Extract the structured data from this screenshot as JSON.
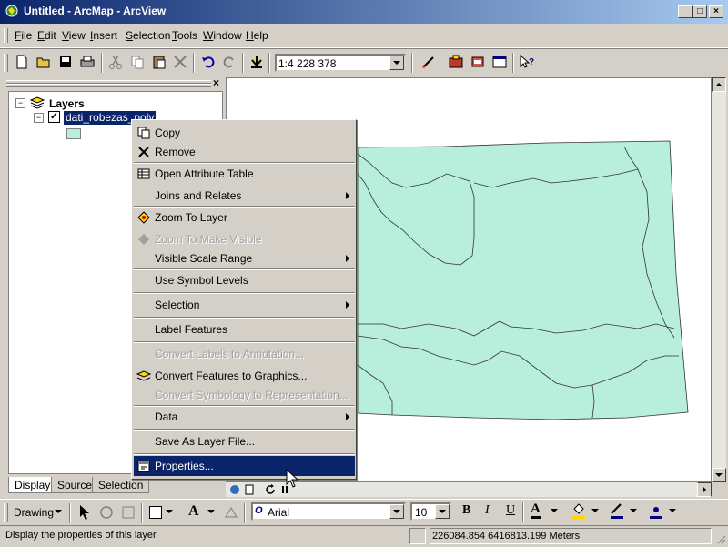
{
  "window": {
    "title": "Untitled - ArcMap - ArcView",
    "minimize": "_",
    "maximize": "□",
    "close": "×"
  },
  "menubar": [
    {
      "label": "File",
      "u": "F",
      "rest": "ile"
    },
    {
      "label": "Edit",
      "u": "E",
      "rest": "dit"
    },
    {
      "label": "View",
      "u": "V",
      "rest": "iew"
    },
    {
      "label": "Insert",
      "u": "I",
      "rest": "nsert"
    },
    {
      "label": "Selection",
      "u": "S",
      "rest": "election"
    },
    {
      "label": "Tools",
      "u": "T",
      "rest": "ools"
    },
    {
      "label": "Window",
      "u": "W",
      "rest": "indow"
    },
    {
      "label": "Help",
      "u": "H",
      "rest": "elp"
    }
  ],
  "toolbar": {
    "scale": "1:4 228 378"
  },
  "toc": {
    "layers_label": "Layers",
    "layer_name": "dati_robezas_poly",
    "tabs": [
      "Display",
      "Source",
      "Selection"
    ],
    "close": "×"
  },
  "context_menu": {
    "items": [
      {
        "label": "Copy",
        "disabled": false,
        "submenu": false
      },
      {
        "label": "Remove",
        "disabled": false,
        "submenu": false
      },
      {
        "label": "Open Attribute Table",
        "disabled": false,
        "submenu": false
      },
      {
        "label": "Joins and Relates",
        "disabled": false,
        "submenu": true
      },
      {
        "label": "Zoom To Layer",
        "disabled": false,
        "submenu": false
      },
      {
        "label": "Zoom To Make Visible",
        "disabled": true,
        "submenu": false
      },
      {
        "label": "Visible Scale Range",
        "disabled": false,
        "submenu": true
      },
      {
        "label": "Use Symbol Levels",
        "disabled": false,
        "submenu": false
      },
      {
        "label": "Selection",
        "disabled": false,
        "submenu": true
      },
      {
        "label": "Label Features",
        "disabled": false,
        "submenu": false
      },
      {
        "label": "Convert Labels to Annotation...",
        "disabled": true,
        "submenu": false
      },
      {
        "label": "Convert Features to Graphics...",
        "disabled": false,
        "submenu": false
      },
      {
        "label": "Convert Symbology to Representation...",
        "disabled": true,
        "submenu": false
      },
      {
        "label": "Data",
        "disabled": false,
        "submenu": true
      },
      {
        "label": "Save As Layer File...",
        "disabled": false,
        "submenu": false
      },
      {
        "label": "Properties...",
        "disabled": false,
        "submenu": false,
        "selected": true
      }
    ]
  },
  "drawing": {
    "label": "Drawing",
    "font": "Arial",
    "size": "10",
    "bold": "B",
    "italic": "I",
    "underline": "U"
  },
  "status": {
    "message": "Display the properties of this layer",
    "coords": "226084.854  6416813.199 Meters"
  },
  "colors": {
    "polygon_fill": "#b8eedc",
    "selection": "#0a246a"
  }
}
